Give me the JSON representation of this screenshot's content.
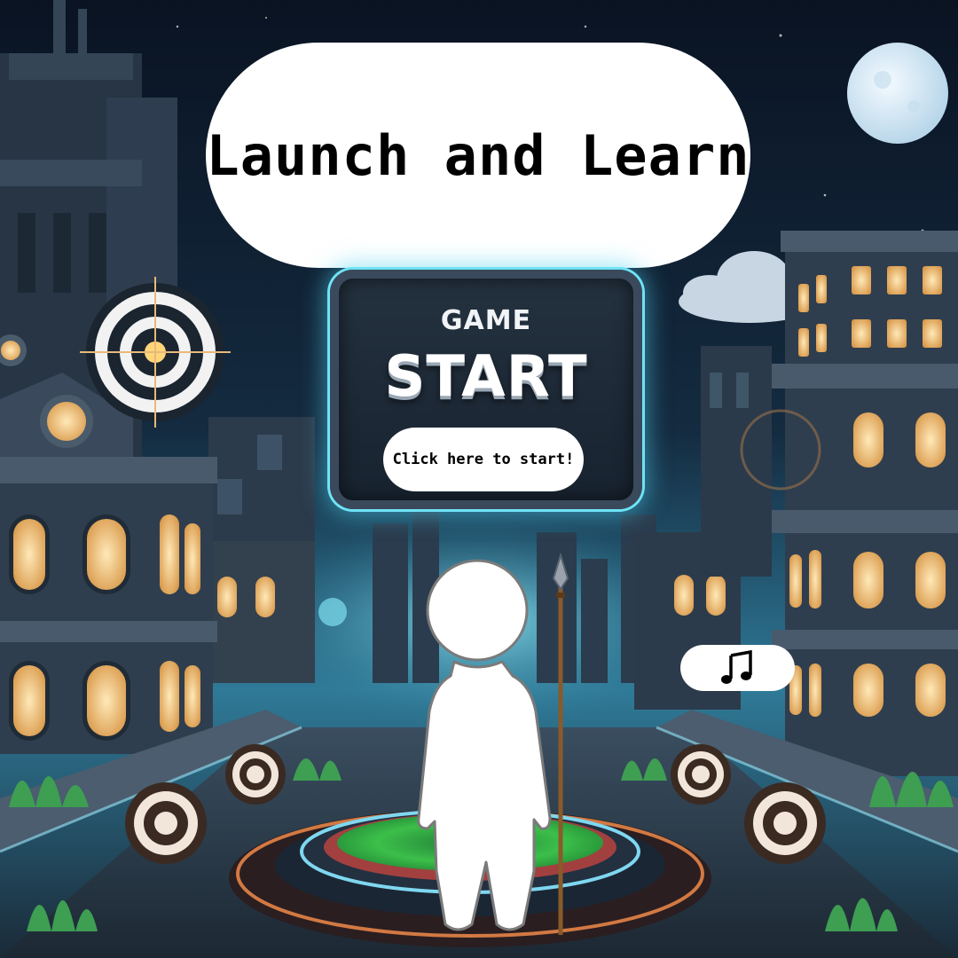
{
  "title": {
    "text": "Launch and Learn"
  },
  "start_panel": {
    "game_label": "GAME",
    "start_label": "START",
    "button_label": "Click here to start!"
  },
  "music_button": {
    "icon": "music-note-icon"
  },
  "colors": {
    "sky_top": "#0b1424",
    "sky_glow": "#2d6f8f",
    "panel_glow": "#6fe3f5",
    "window_light": "#f5d79a",
    "pad_green": "#3cbf4a",
    "pill_white": "#ffffff"
  }
}
